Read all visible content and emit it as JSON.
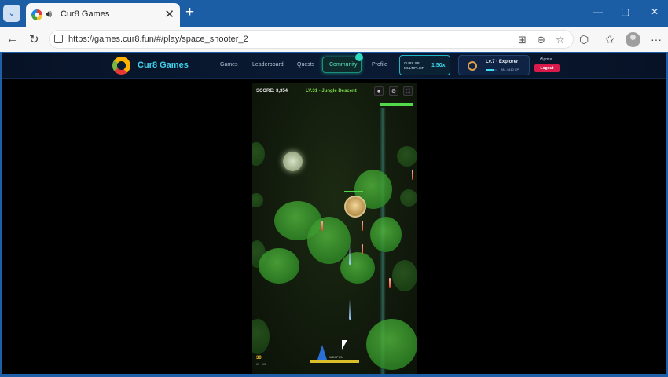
{
  "browser": {
    "tab": {
      "title": "Cur8 Games",
      "favicon": "cur8-logo-icon",
      "audio_icon": "speaker-icon",
      "close_label": "✕"
    },
    "new_tab_label": "+",
    "tab_list_icon": "chevron-down-icon",
    "window_controls": {
      "minimize": "—",
      "maximize": "▢",
      "close": "✕"
    },
    "address": {
      "url": "https://games.cur8.fun/#/play/space_shooter_2"
    },
    "nav_icons": {
      "back": "←",
      "reload": "↻"
    },
    "toolbar_icons": [
      "apps-icon",
      "zoom-icon",
      "favorite-star-icon",
      "extensions-icon",
      "favorites-icon",
      "collections-icon",
      "profile-avatar-icon",
      "more-icon"
    ],
    "toolbar_glyphs": {
      "apps": "⊞",
      "zoom": "⊖",
      "star": "☆",
      "extensions": "⬡",
      "favorites": "✩",
      "collections": "▣",
      "more": "···"
    }
  },
  "site": {
    "brand": "Cur8 Games",
    "nav": [
      "Games",
      "Leaderboard",
      "Quests",
      "Community",
      "Profile"
    ],
    "xp_multiplier_label": "CUR8 XP MULTIPLIER",
    "xp_multiplier_value": "1.50x",
    "profile": {
      "level": "Lv.7 · Explorer",
      "xp": "281 / 410 XP",
      "xp_progress": 0.69,
      "username": "r5pmur",
      "logout_label": "Logout"
    }
  },
  "game": {
    "score": "SCORE: 3,354",
    "level": "LV.31 - Jungle Descent",
    "buttons": {
      "ship": "♠",
      "settings": "⚙",
      "fullscreen": "⛶"
    },
    "boss_hp": 1.0,
    "lives": "30",
    "hud_small_text": "01 · 005",
    "power_label": "WEAPON",
    "power_fill": 1.0
  },
  "colors": {
    "accent": "#3fd0e8",
    "logout": "#d81b4a",
    "level_text": "#7ddc4a"
  }
}
